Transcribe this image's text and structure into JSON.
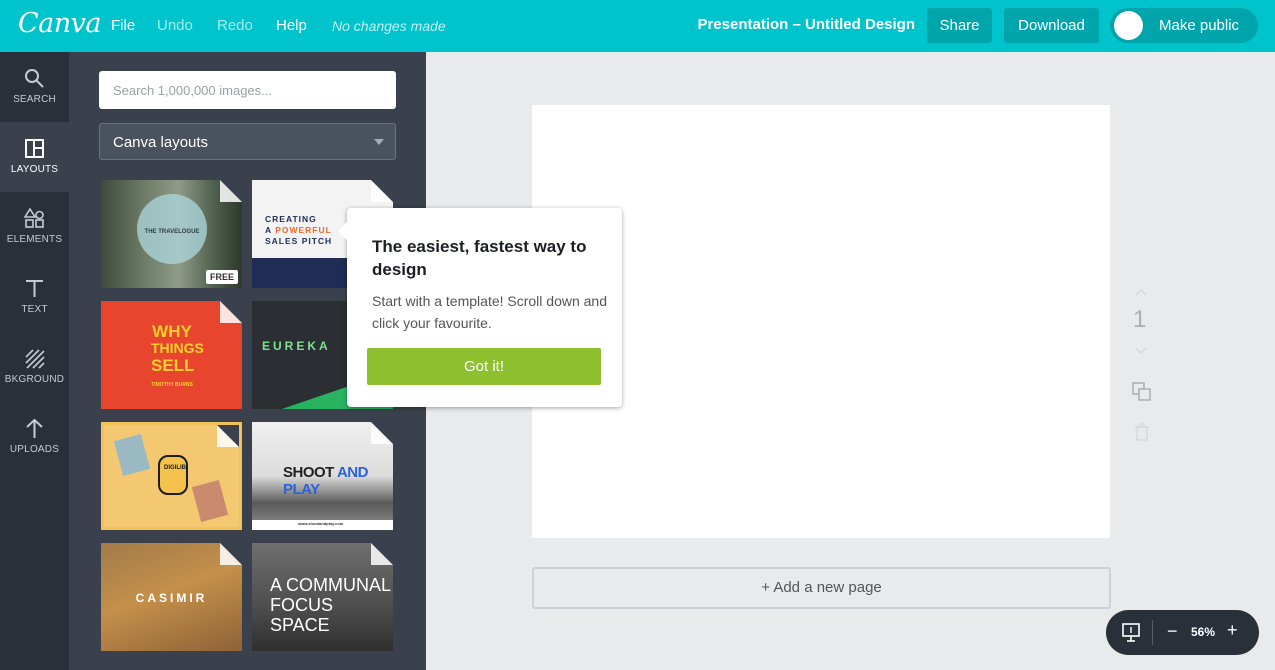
{
  "app": {
    "logo": "Canva"
  },
  "menu": {
    "file": "File",
    "undo": "Undo",
    "redo": "Redo",
    "help": "Help",
    "status": "No changes made"
  },
  "header": {
    "title": "Presentation – Untitled Design",
    "share": "Share",
    "download": "Download",
    "make_public": "Make public"
  },
  "rail": {
    "search": "SEARCH",
    "layouts": "LAYOUTS",
    "elements": "ELEMENTS",
    "text": "TEXT",
    "background": "BKGROUND",
    "uploads": "UPLOADS"
  },
  "panel": {
    "search_placeholder": "Search 1,000,000 images...",
    "select_value": "Canva layouts",
    "free_badge": "FREE",
    "templates": [
      {
        "name": "THE TRAVELOGUE"
      },
      {
        "name": "CREATING A POWERFUL SALES PITCH",
        "line1": "CREATING",
        "line2a": "A ",
        "line2b": "POWERFUL",
        "line3": "SALES PITCH"
      },
      {
        "name": "WHY THINGS SELL",
        "line1": "WHY",
        "line2": "THINGS",
        "line3": "SELL",
        "author": "TIMOTHY BURNS"
      },
      {
        "name": "EUREKA"
      },
      {
        "name": "DIGILIB"
      },
      {
        "name": "SHOOT AND PLAY",
        "w1": "SHOOT ",
        "w2": "AND ",
        "w3": "PLAY",
        "url": "www.shootandplay.com"
      },
      {
        "name": "CASIMIR"
      },
      {
        "name": "A COMMUNAL FOCUS SPACE",
        "line1": "A COMMUNAL",
        "line2": "FOCUS SPACE"
      }
    ]
  },
  "tooltip": {
    "title": "The easiest, fastest way to design",
    "body": "Start with a template! Scroll down and click your favourite.",
    "button": "Got it!"
  },
  "canvas": {
    "page_number": "1",
    "add_page": "+ Add a new page"
  },
  "zoom": {
    "value": "56%",
    "minus": "−",
    "plus": "+"
  },
  "colors": {
    "topbar": "#00c4cc",
    "rail": "#293039",
    "panel": "#3a414c",
    "accent_button": "#8dbf2e"
  }
}
